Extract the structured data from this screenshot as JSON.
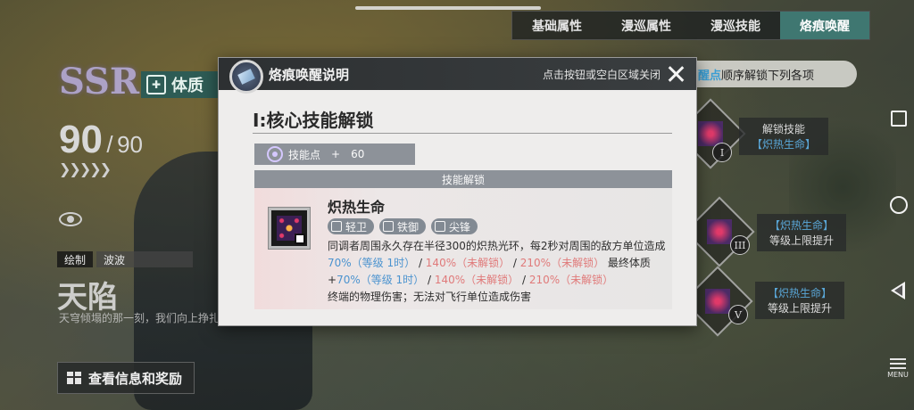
{
  "tabs": [
    "基础属性",
    "漫巡属性",
    "漫巡技能",
    "烙痕唤醒"
  ],
  "active_tab_index": 3,
  "character": {
    "rarity": "SSR",
    "class_label": "体质",
    "level_current": "90",
    "level_separator": "/",
    "level_max": "90",
    "credit_label": "绘制",
    "credit_value": "波波",
    "name": "天陷",
    "quote": "天穹倾塌的那一刻，我们向上挣扎",
    "info_button_label": "查看信息和奖励"
  },
  "right_panel": {
    "unlock_hint_highlight": "醒点",
    "unlock_hint_rest": "顺序解锁下列各项",
    "nodes": [
      {
        "roman": "I",
        "title": "解锁技能",
        "subtitle": "【炽热生命】"
      },
      {
        "roman": "III",
        "title": "【炽热生命】",
        "subtitle": "等级上限提升"
      },
      {
        "roman": "V",
        "title": "【炽热生命】",
        "subtitle": "等级上限提升"
      }
    ]
  },
  "system_nav": {
    "menu_label": "MENU"
  },
  "modal": {
    "title": "烙痕唤醒说明",
    "close_hint": "点击按钮或空白区域关闭",
    "section_heading": "I:核心技能解锁",
    "skill_points_label": "技能点",
    "skill_points_sign": "+",
    "skill_points_value": "60",
    "unlock_label": "技能解锁",
    "skill": {
      "name": "炽热生命",
      "tags": [
        "轻卫",
        "铁御",
        "尖锋"
      ],
      "desc_part1": "同调者周围永久存在半径300的炽热光环，每2秒对周围的敌方单位造成",
      "dmg_lv1": "70%（等级 1时）",
      "sep1": " / ",
      "dmg_locked1": "140%（未解锁）",
      "sep2": " / ",
      "dmg_locked2": "210%（未解锁）",
      "desc_part2": "最终体质+",
      "con_lv1": "70%（等级 1时）",
      "sep3": " / ",
      "con_locked1": "140%（未解锁）",
      "sep4": " / ",
      "con_locked2": "210%（未解锁）",
      "desc_part3": "终端的物理伤害；无法对飞行单位造成伤害"
    }
  },
  "colors": {
    "active_tab": "#3f7771",
    "value_blue": "#4b93cf",
    "value_red": "#e07a7a"
  }
}
